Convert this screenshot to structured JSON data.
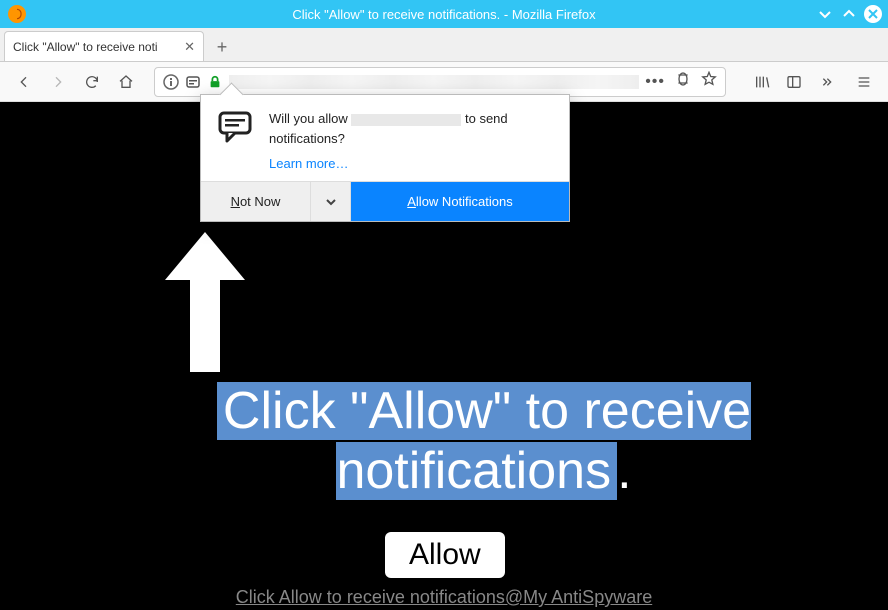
{
  "window": {
    "title": "Click \"Allow\" to receive notifications. - Mozilla Firefox"
  },
  "tab": {
    "title": "Click \"Allow\" to receive noti"
  },
  "permission_prompt": {
    "question_prefix": "Will you allow",
    "question_suffix": "to send notifications?",
    "learn_more": "Learn more…",
    "not_now": "Not Now",
    "allow": "Allow Notifications"
  },
  "page": {
    "headline": "Click \"Allow\" to receive notifications",
    "headline_punct": ".",
    "allow_button": "Allow",
    "caption": "Click Allow to receive notifications@My AntiSpyware"
  }
}
